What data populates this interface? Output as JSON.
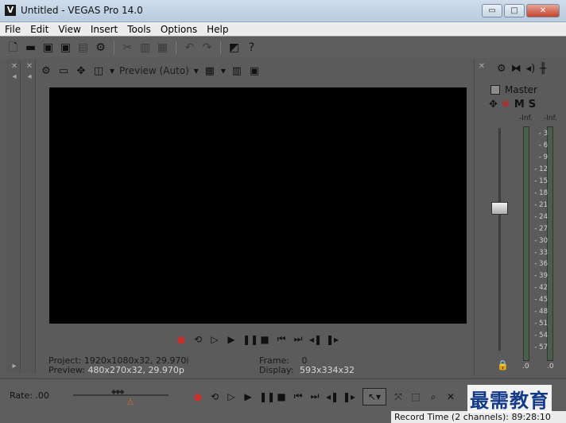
{
  "window": {
    "title": "Untitled - VEGAS Pro 14.0",
    "controls": {
      "minimize": "▭",
      "maximize": "□",
      "close": "✕"
    }
  },
  "menu": [
    "File",
    "Edit",
    "View",
    "Insert",
    "Tools",
    "Options",
    "Help"
  ],
  "toolbar": {
    "icons": [
      "new-file-icon",
      "open-folder-icon",
      "save-icon",
      "save-as-icon",
      "render-icon",
      "properties-icon",
      "cut-icon",
      "copy-icon",
      "paste-icon",
      "undo-icon",
      "redo-icon",
      "split-icon",
      "help-icon"
    ]
  },
  "preview": {
    "quality": "Preview (Auto)",
    "project_label": "Project:",
    "project_value": "1920x1080x32, 29.970i",
    "preview_label": "Preview:",
    "preview_value": "480x270x32, 29.970p",
    "frame_label": "Frame:",
    "frame_value": "0",
    "display_label": "Display:",
    "display_value": "593x334x32"
  },
  "mixer": {
    "master_label": "Master",
    "mute_label": "M",
    "solo_label": "S",
    "peak_left": "-Inf.",
    "peak_right": "-Inf.",
    "scale": [
      "3",
      "6",
      "9",
      "12",
      "15",
      "18",
      "21",
      "24",
      "27",
      "30",
      "33",
      "36",
      "39",
      "42",
      "45",
      "48",
      "51",
      "54",
      "57"
    ],
    "scale_prefix": "-",
    "meter_left_bottom": ".0",
    "meter_right_bottom": ".0"
  },
  "bottom": {
    "rate_label": "Rate: .00",
    "record_time": "Record Time (2 channels): 89:28:10"
  },
  "watermark": "最需教育",
  "colors": {
    "workspace": "#5a5a5a",
    "record": "#c9302c",
    "meter": "#46604a"
  }
}
